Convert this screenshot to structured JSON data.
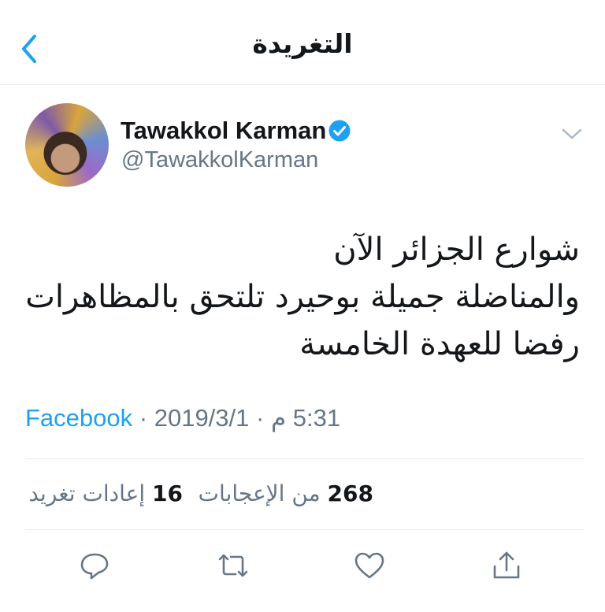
{
  "header": {
    "title": "التغريدة",
    "back_icon": "chevron-left-icon",
    "accent": "#1da1f2"
  },
  "tweet": {
    "author_name": "Tawakkol Karman",
    "author_handle": "@TawakkolKarman",
    "verified": true,
    "text_lines": [
      "شوارع الجزائر الآن",
      "والمناضلة جميلة بوحيرد تلتحق بالمظاهرات",
      "رفضا للعهدة الخامسة"
    ],
    "time": "5:31 م",
    "date": "2019/3/1",
    "source": "Facebook",
    "separator": "·"
  },
  "stats": {
    "likes_count": "268",
    "likes_label": "من الإعجابات",
    "retweets_count": "16",
    "retweets_label": "إعادات تغريد"
  },
  "actions": {
    "reply_icon": "reply-icon",
    "retweet_icon": "retweet-icon",
    "like_icon": "heart-icon",
    "share_icon": "share-icon"
  },
  "colors": {
    "text": "#14171a",
    "secondary": "#657786",
    "link": "#1da1f2",
    "divider": "#e6ecf0"
  }
}
